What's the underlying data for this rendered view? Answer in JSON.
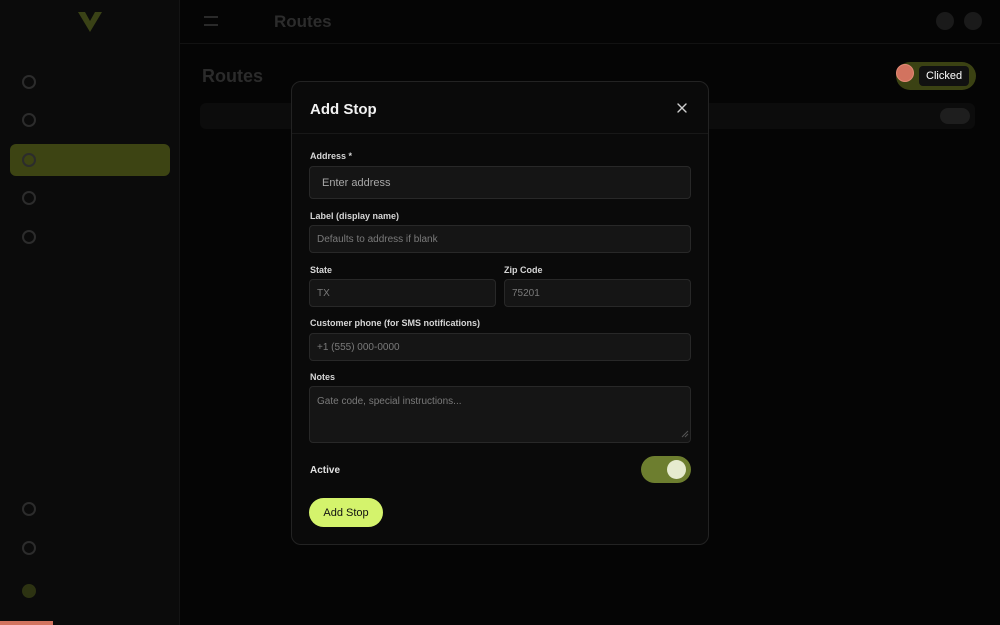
{
  "app": {
    "topbar_title": "Routes",
    "page_title": "Routes"
  },
  "sidebar": {
    "items": [
      {
        "label": "",
        "icon": "home-icon"
      },
      {
        "label": "",
        "icon": "truck-icon"
      },
      {
        "label": "",
        "icon": "route-icon",
        "active": true
      },
      {
        "label": "",
        "icon": "user-icon"
      },
      {
        "label": "",
        "icon": "calendar-icon"
      }
    ],
    "bottom_items": [
      {
        "label": "",
        "icon": "help-icon"
      },
      {
        "label": "",
        "icon": "gear-icon"
      },
      {
        "label": "",
        "icon": "avatar"
      }
    ]
  },
  "overlay": {
    "click_label": "Clicked",
    "click_marker_color": "#d2735f"
  },
  "modal": {
    "title": "Add Stop",
    "close_icon": "close-icon",
    "fields": {
      "address": {
        "label": "Address *",
        "placeholder": "Enter address",
        "value": ""
      },
      "display_name": {
        "label": "Label (display name)",
        "placeholder": "Defaults to address if blank",
        "value": ""
      },
      "state": {
        "label": "State",
        "placeholder": "TX",
        "value": ""
      },
      "zip": {
        "label": "Zip Code",
        "placeholder": "75201",
        "value": ""
      },
      "phone": {
        "label": "Customer phone (for SMS notifications)",
        "placeholder": "+1 (555) 000-0000",
        "value": ""
      },
      "notes": {
        "label": "Notes",
        "placeholder": "Gate code, special instructions...",
        "value": ""
      }
    },
    "active": {
      "label": "Active",
      "on": true
    },
    "submit_label": "Add Stop"
  },
  "colors": {
    "accent": "#d4f36c",
    "toggle_on": "#6d7e2f",
    "modal_bg": "#0a0a0a",
    "input_bg": "#151515"
  }
}
